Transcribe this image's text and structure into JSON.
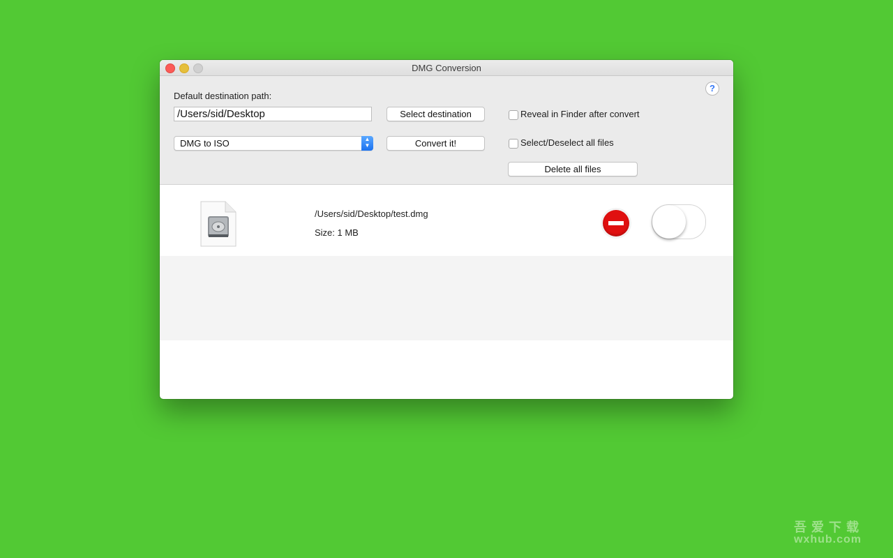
{
  "window": {
    "title": "DMG Conversion"
  },
  "toolbar": {
    "destination_label": "Default destination path:",
    "destination_value": "/Users/sid/Desktop",
    "select_destination_label": "Select destination",
    "conversion_mode": "DMG to ISO",
    "convert_label": "Convert it!",
    "reveal_label": "Reveal in Finder after convert",
    "reveal_checked": false,
    "select_all_label": "Select/Deselect all files",
    "select_all_checked": false,
    "delete_all_label": "Delete all files",
    "help_label": "?"
  },
  "files": [
    {
      "path": "/Users/sid/Desktop/test.dmg",
      "size": "Size: 1 MB",
      "icon": "disk-image-document-icon",
      "selected": false
    }
  ],
  "watermark": {
    "line1": "吾 爱 下 载",
    "line2": "wxhub.com"
  },
  "colors": {
    "background": "#52c934",
    "remove": "#e01010",
    "accent": "#1b72f0"
  }
}
